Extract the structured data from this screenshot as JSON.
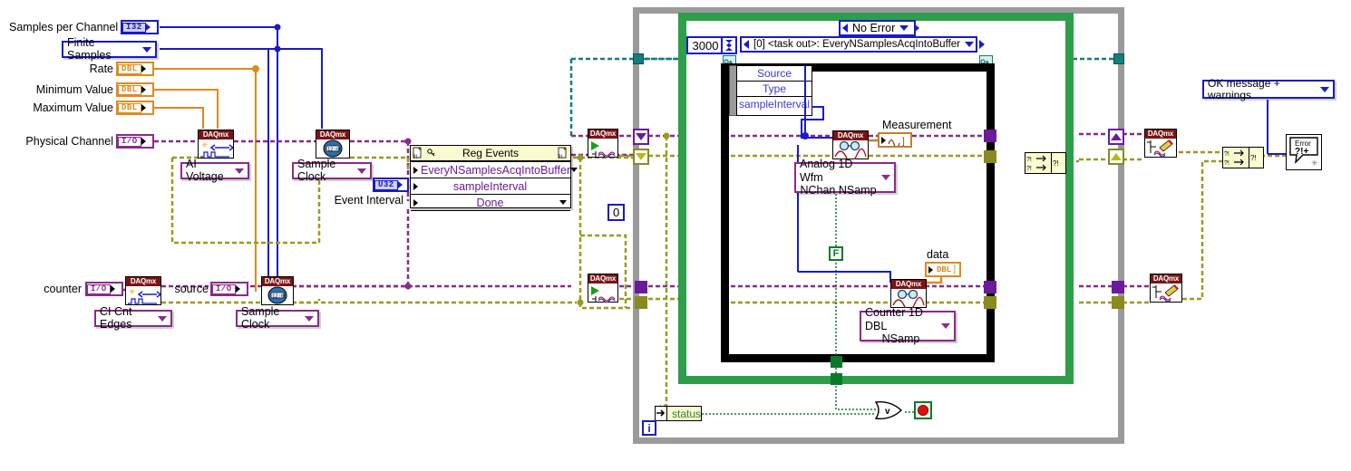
{
  "title": "LabVIEW Block Diagram - DAQmx Every N Samples Acquired Into Buffer",
  "controls": {
    "samples_per_channel": {
      "label": "Samples per Channel",
      "type": "I32"
    },
    "sample_mode": {
      "value": "Finite Samples"
    },
    "rate": {
      "label": "Rate",
      "type": "DBL"
    },
    "minimum_value": {
      "label": "Minimum Value",
      "type": "DBL"
    },
    "maximum_value": {
      "label": "Maximum Value",
      "type": "DBL"
    },
    "physical_channel": {
      "label": "Physical Channel",
      "type": "I/O"
    },
    "counter": {
      "label": "counter",
      "type": "I/O"
    },
    "source": {
      "label": "source",
      "type": "I/O"
    },
    "event_interval": {
      "label": "Event Interval",
      "type": "U32"
    }
  },
  "daqmx_config": {
    "ai_voltage": "AI Voltage",
    "sample_clock_ai": "Sample Clock",
    "ci_cnt_edges": "CI Cnt Edges",
    "sample_clock_ci": "Sample Clock",
    "daqmx_tag": "DAQmx"
  },
  "reg_events": {
    "title": "Reg Events",
    "rows": [
      {
        "label": "EveryNSamplesAcqIntoBuffer",
        "has_caret": true
      },
      {
        "label": "sampleInterval",
        "has_caret": false
      },
      {
        "label": "Done",
        "has_caret": true
      }
    ]
  },
  "event_structure": {
    "timeout_value": "3000",
    "case_selector": "[0] <task out>: EveryNSamplesAcqIntoBuffer",
    "error_selector": "No Error",
    "event_data": [
      "Source",
      "Type",
      "sampleInterval"
    ]
  },
  "read_nodes": {
    "analog_read_type": "Analog 1D Wfm\nNChan NSamp",
    "analog_read_line1": "Analog 1D Wfm",
    "analog_read_line2": "NChan NSamp",
    "counter_read_line1": "Counter 1D DBL",
    "counter_read_line2": "NSamp"
  },
  "indicators": {
    "measurement": {
      "label": "Measurement",
      "type": "waveform"
    },
    "data": {
      "label": "data",
      "type": "DBL"
    },
    "status": {
      "label": "status"
    }
  },
  "constants": {
    "zero": "0",
    "false": "F",
    "iteration": "i"
  },
  "error_handling": {
    "message_mode": "OK message + warnings",
    "handler_icon": "Error ?!+"
  },
  "colors": {
    "error_wire": "#8b2a8b",
    "task_wire": "#9a9a20",
    "numeric_orange": "#e08a1e",
    "numeric_blue": "#1a1ac8",
    "event_green": "#2e9e4a",
    "loop_gray": "#9a9a9a",
    "daqmx_red": "#7a1414"
  }
}
